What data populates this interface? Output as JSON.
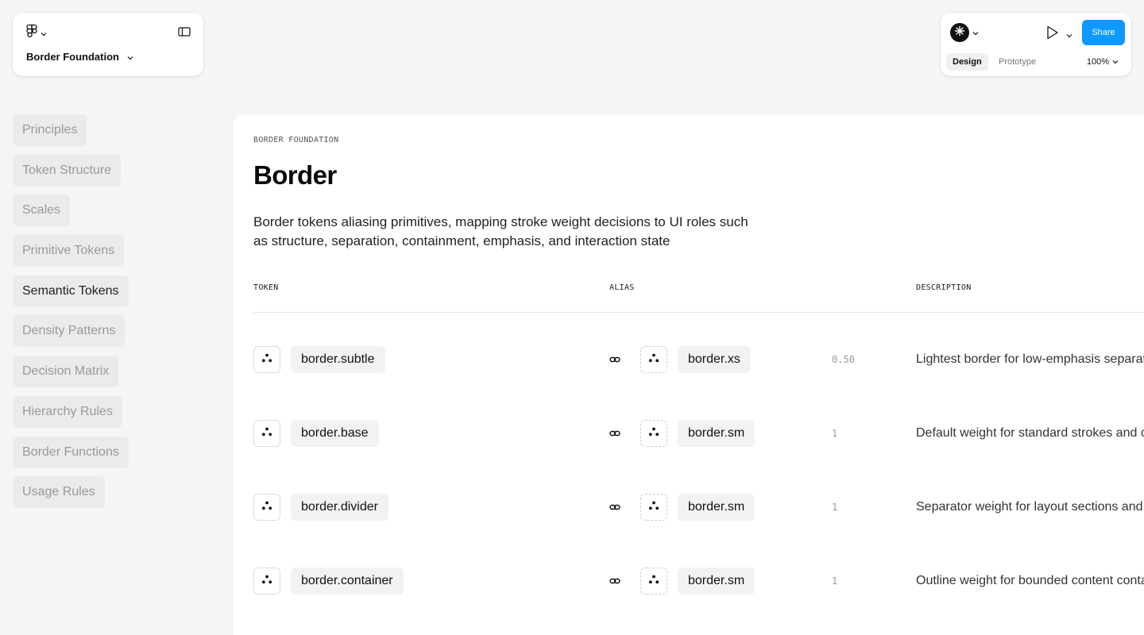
{
  "file": {
    "name": "Border Foundation"
  },
  "toolbar": {
    "share_label": "Share",
    "tabs": [
      {
        "label": "Design",
        "active": true
      },
      {
        "label": "Prototype",
        "active": false
      }
    ],
    "zoom": "100%",
    "accent_color": "#0d99ff"
  },
  "nav": {
    "items": [
      {
        "label": "Principles",
        "active": false
      },
      {
        "label": "Token Structure",
        "active": false
      },
      {
        "label": "Scales",
        "active": false
      },
      {
        "label": "Primitive Tokens",
        "active": false
      },
      {
        "label": "Semantic Tokens",
        "active": true
      },
      {
        "label": "Density Patterns",
        "active": false
      },
      {
        "label": "Decision Matrix",
        "active": false
      },
      {
        "label": "Hierarchy Rules",
        "active": false
      },
      {
        "label": "Border Functions",
        "active": false
      },
      {
        "label": "Usage Rules",
        "active": false
      }
    ]
  },
  "main": {
    "eyebrow": "BORDER FOUNDATION",
    "title": "Border",
    "description": "Border tokens aliasing primitives, mapping stroke weight decisions to UI roles such as structure, separation, containment, emphasis, and interaction state",
    "columns": {
      "token": "TOKEN",
      "alias": "ALIAS",
      "description": "DESCRIPTION"
    },
    "rows": [
      {
        "token": "border.subtle",
        "alias": "border.xs",
        "value": "0.50",
        "description": "Lightest border for low-emphasis separati"
      },
      {
        "token": "border.base",
        "alias": "border.sm",
        "value": "1",
        "description": "Default weight for standard strokes and c"
      },
      {
        "token": "border.divider",
        "alias": "border.sm",
        "value": "1",
        "description": "Separator weight for layout sections and"
      },
      {
        "token": "border.container",
        "alias": "border.sm",
        "value": "1",
        "description": "Outline weight for bounded content conta"
      }
    ]
  },
  "icons": {
    "file_menu": "figma-logo-icon",
    "panel_toggle": "sidebar-toggle-icon",
    "avatar": "asterisk-avatar-icon",
    "play": "play-icon",
    "token_type": "three-dots-icon",
    "alias_link": "link-icon"
  }
}
